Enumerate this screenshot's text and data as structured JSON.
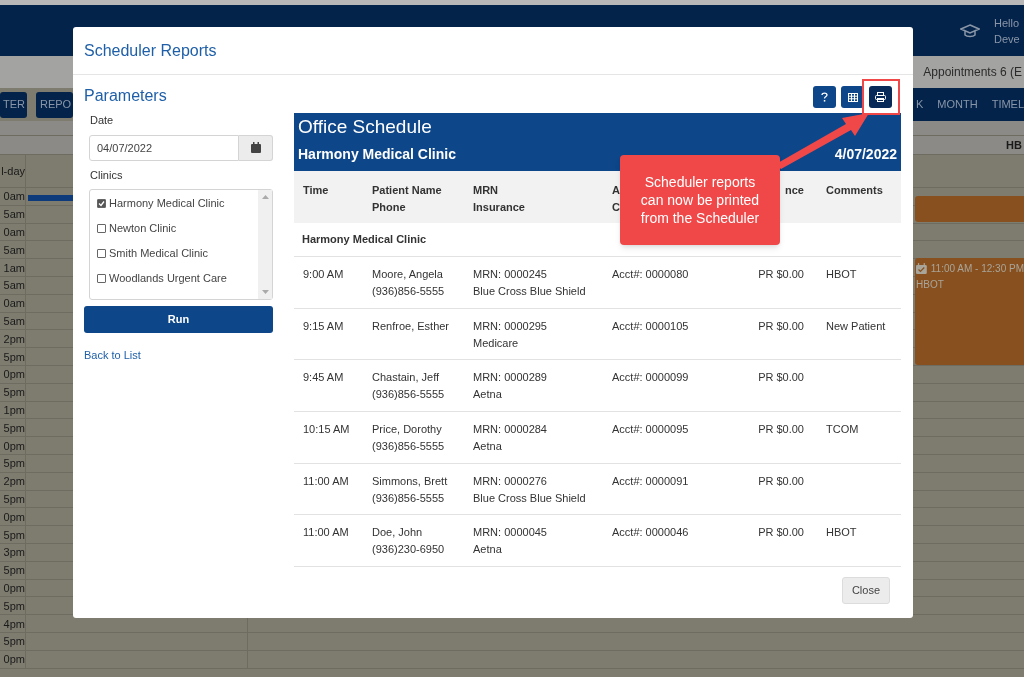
{
  "app": {
    "greeting": [
      "Hello",
      "Deve"
    ],
    "subheader": "Appointments 6 (E",
    "left_buttons": [
      "TER",
      "REPO"
    ],
    "view_tabs": [
      "K",
      "MONTH",
      "TIMEL"
    ],
    "grid_header": "HB",
    "all_day_label": "l-day",
    "time_labels": [
      "0am",
      "5am",
      "0am",
      "5am",
      "1am",
      "5am",
      "0am",
      "5am",
      "2pm",
      "5pm",
      "0pm",
      "5pm",
      "1pm",
      "5pm",
      "0pm",
      "5pm",
      "2pm",
      "5pm",
      "0pm",
      "5pm",
      "3pm",
      "5pm",
      "0pm",
      "5pm",
      "4pm",
      "5pm",
      "0pm"
    ],
    "events": [
      {
        "kind": "bar"
      },
      {
        "kind": "appointment",
        "time": "11:00 AM - 12:30 PM",
        "title": "HBOT"
      }
    ]
  },
  "dialog": {
    "title": "Scheduler Reports",
    "parameters": {
      "heading": "Parameters",
      "date_label": "Date",
      "date_value": "04/07/2022",
      "clinics_label": "Clinics",
      "clinics": [
        {
          "label": "Harmony Medical Clinic",
          "checked": true
        },
        {
          "label": "Newton Clinic",
          "checked": false
        },
        {
          "label": "Smith Medical Clinic",
          "checked": false
        },
        {
          "label": "Woodlands Urgent Care",
          "checked": false
        }
      ],
      "run_button": "Run",
      "back_link": "Back to List"
    },
    "toolbar": [
      {
        "kind": "help",
        "highlighted": false
      },
      {
        "kind": "grid",
        "highlighted": false
      },
      {
        "kind": "print",
        "highlighted": true
      }
    ],
    "report": {
      "title": "Office Schedule",
      "clinic": "Harmony Medical Clinic",
      "date": "4/07/2022",
      "columns": [
        {
          "lines": [
            "Time"
          ]
        },
        {
          "lines": [
            "Patient Name",
            "Phone"
          ]
        },
        {
          "lines": [
            "MRN",
            "Insurance"
          ]
        },
        {
          "lines": [
            "A",
            "C"
          ]
        },
        {
          "lines": [
            "nce"
          ]
        },
        {
          "lines": [
            "Comments"
          ]
        }
      ],
      "group": "Harmony Medical Clinic",
      "rows": [
        {
          "time": "9:00 AM",
          "patient": "Moore, Angela",
          "phone": "(936)856-5555",
          "mrn": "MRN: 0000245",
          "insurance": "Blue Cross Blue Shield",
          "account": "Acct#: 0000080",
          "balance": "PR $0.00",
          "comments": "HBOT"
        },
        {
          "time": "9:15 AM",
          "patient": "Renfroe, Esther",
          "mrn": "MRN: 0000295",
          "insurance": "Medicare",
          "account": "Acct#: 0000105",
          "balance": "PR $0.00",
          "comments": "New Patient"
        },
        {
          "time": "9:45 AM",
          "patient": "Chastain, Jeff",
          "phone": "(936)856-5555",
          "mrn": "MRN: 0000289",
          "insurance": "Aetna",
          "account": "Acct#: 0000099",
          "balance": "PR $0.00"
        },
        {
          "time": "10:15 AM",
          "patient": "Price, Dorothy",
          "phone": "(936)856-5555",
          "mrn": "MRN: 0000284",
          "insurance": "Aetna",
          "account": "Acct#: 0000095",
          "balance": "PR $0.00",
          "comments": "TCOM"
        },
        {
          "time": "11:00 AM",
          "patient": "Simmons, Brett",
          "phone": "(936)856-5555",
          "mrn": "MRN: 0000276",
          "insurance": "Blue Cross Blue Shield",
          "account": "Acct#: 0000091",
          "balance": "PR $0.00"
        },
        {
          "time": "11:00 AM",
          "patient": "Doe, John",
          "phone": "(936)230-6950",
          "mrn": "MRN: 0000045",
          "insurance": "Aetna",
          "account": "Acct#: 0000046",
          "balance": "PR $0.00",
          "comments": "HBOT"
        }
      ]
    },
    "callout": "Scheduler reports can now be printed from the Scheduler",
    "close_button": "Close"
  }
}
